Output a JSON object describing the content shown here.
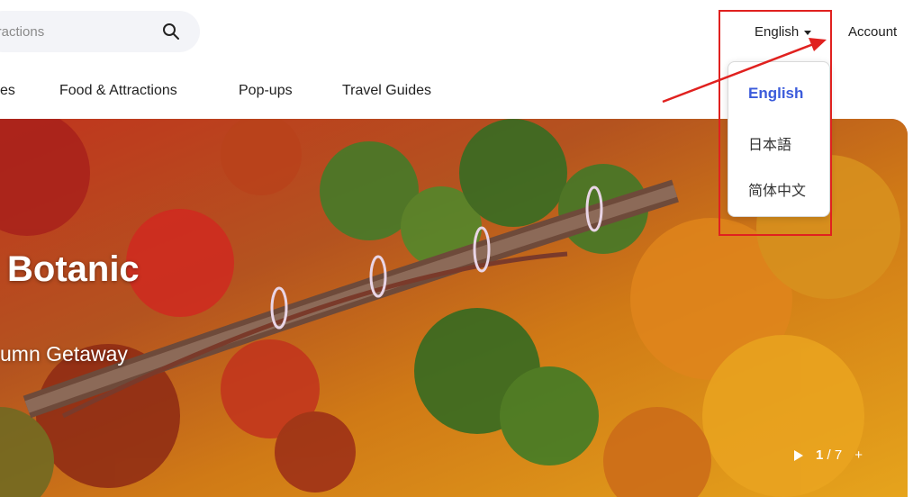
{
  "search": {
    "placeholder": "attractions"
  },
  "header": {
    "language_label": "English",
    "account_label": "Account"
  },
  "nav": [
    "es",
    "Food & Attractions",
    "Pop-ups",
    "Travel Guides"
  ],
  "language_menu": {
    "options": [
      "English",
      "日本語",
      "简体中文"
    ],
    "selected": "English"
  },
  "hero": {
    "title": "Botanic",
    "subtitle": "umn Getaway",
    "page_current": "1",
    "page_separator": "/",
    "page_total": "7",
    "plus": "+"
  },
  "colors": {
    "accent": "#3b5bdb",
    "annotation_red": "#e0211f"
  }
}
